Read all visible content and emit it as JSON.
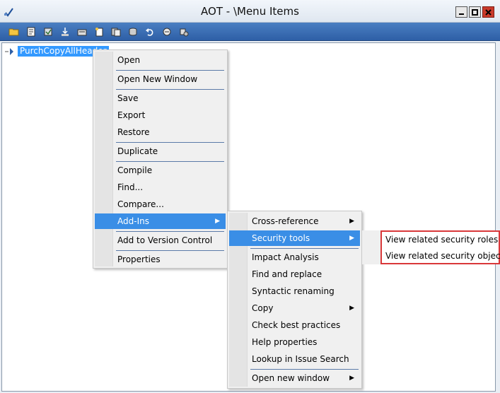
{
  "window": {
    "title": "AOT - \\Menu Items"
  },
  "toolbar": {
    "buttons": [
      "open-folder-icon",
      "properties-icon",
      "compile-icon",
      "import-icon",
      "export-icon",
      "new-icon",
      "save-all-icon",
      "restore-icon",
      "undo-icon",
      "find-icon",
      "settings-icon"
    ]
  },
  "tree": {
    "node_label": "PurchCopyAllHeader"
  },
  "context_menu": {
    "items": [
      {
        "label": "Open"
      },
      {
        "label": "Open New Window"
      },
      {
        "label": "Save"
      },
      {
        "label": "Export"
      },
      {
        "label": "Restore"
      },
      {
        "label": "Duplicate"
      },
      {
        "label": "Compile"
      },
      {
        "label": "Find..."
      },
      {
        "label": "Compare..."
      },
      {
        "label": "Add-Ins"
      },
      {
        "label": "Add to Version Control"
      },
      {
        "label": "Properties"
      }
    ]
  },
  "addins_menu": {
    "items": [
      {
        "label": "Cross-reference"
      },
      {
        "label": "Security tools"
      },
      {
        "label": "Impact Analysis"
      },
      {
        "label": "Find and replace"
      },
      {
        "label": "Syntactic renaming"
      },
      {
        "label": "Copy"
      },
      {
        "label": "Check best practices"
      },
      {
        "label": "Help properties"
      },
      {
        "label": "Lookup in Issue Search"
      },
      {
        "label": "Open new window"
      }
    ]
  },
  "security_menu": {
    "items": [
      {
        "label": "View related security roles"
      },
      {
        "label": "View related security objects"
      }
    ]
  },
  "colors": {
    "highlight": "#3a8ee6",
    "toolbar": "#3d6fb6",
    "callout_border": "#d9383a"
  }
}
